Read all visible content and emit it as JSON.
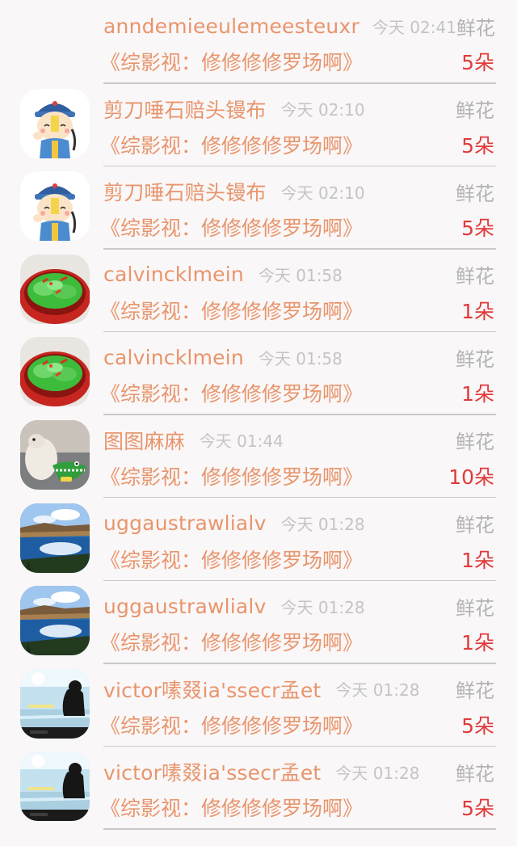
{
  "records": [
    {
      "username": "anndemieeulemeesteuxr",
      "time": "今天 02:41",
      "gift": "鲜花",
      "work": "《综影视：修修修修罗场啊》",
      "count": "5朵",
      "avatar": "none"
    },
    {
      "username": "剪刀唾石赔头镘布",
      "time": "今天 02:10",
      "gift": "鲜花",
      "work": "《综影视：修修修修罗场啊》",
      "count": "5朵",
      "avatar": "cartoon-boy-avatar"
    },
    {
      "username": "剪刀唾石赔头镘布",
      "time": "今天 02:10",
      "gift": "鲜花",
      "work": "《综影视：修修修修罗场啊》",
      "count": "5朵",
      "avatar": "cartoon-boy-avatar"
    },
    {
      "username": "calvincklmein",
      "time": "今天 01:58",
      "gift": "鲜花",
      "work": "《综影视：修修修修罗场啊》",
      "count": "1朵",
      "avatar": "vegetable-dish-avatar"
    },
    {
      "username": "calvincklmein",
      "time": "今天 01:58",
      "gift": "鲜花",
      "work": "《综影视：修修修修罗场啊》",
      "count": "1朵",
      "avatar": "vegetable-dish-avatar"
    },
    {
      "username": "图图麻麻",
      "time": "今天 01:44",
      "gift": "鲜花",
      "work": "《综影视：修修修修罗场啊》",
      "count": "10朵",
      "avatar": "dog-toy-avatar"
    },
    {
      "username": "uggaustrawlialv",
      "time": "今天 01:28",
      "gift": "鲜花",
      "work": "《综影视：修修修修罗场啊》",
      "count": "1朵",
      "avatar": "lake-landscape-avatar"
    },
    {
      "username": "uggaustrawlialv",
      "time": "今天 01:28",
      "gift": "鲜花",
      "work": "《综影视：修修修修罗场啊》",
      "count": "1朵",
      "avatar": "lake-landscape-avatar"
    },
    {
      "username": "victor嗉叕ia'ssecr孟et",
      "time": "今天 01:28",
      "gift": "鲜花",
      "work": "《综影视：修修修修罗场啊》",
      "count": "5朵",
      "avatar": "silhouette-sea-avatar"
    },
    {
      "username": "victor嗉叕ia'ssecr孟et",
      "time": "今天 01:28",
      "gift": "鲜花",
      "work": "《综影视：修修修修罗场啊》",
      "count": "5朵",
      "avatar": "silhouette-sea-avatar"
    }
  ]
}
